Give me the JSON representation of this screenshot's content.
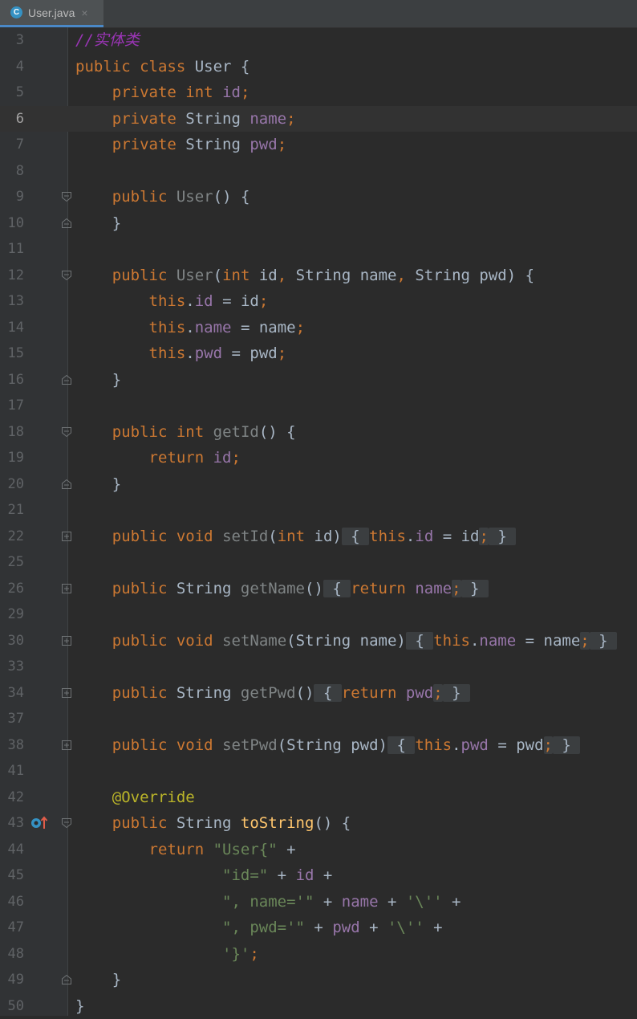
{
  "tab": {
    "file_icon_letter": "C",
    "file_name": "User.java",
    "close_glyph": "×"
  },
  "colors": {
    "keyword": "#cc7832",
    "field": "#9876aa",
    "method_declaration": "#ffc66d",
    "unused_method": "#7f8485",
    "string": "#6a8759",
    "annotation": "#bbb529",
    "comment": "#9a35b5",
    "plain": "#a9b7c6",
    "background": "#2b2b2b"
  },
  "gutter": {
    "icons": [
      "fold-open-icon",
      "fold-close-icon",
      "fold-expand-icon",
      "override-method-icon"
    ]
  },
  "lines": [
    {
      "num": "3",
      "text": "//实体类"
    },
    {
      "num": "4",
      "text": "public class User {"
    },
    {
      "num": "5",
      "text": "    private int id;"
    },
    {
      "num": "6",
      "text": "    private String name;",
      "current": true
    },
    {
      "num": "7",
      "text": "    private String pwd;"
    },
    {
      "num": "8",
      "text": ""
    },
    {
      "num": "9",
      "text": "    public User() {"
    },
    {
      "num": "10",
      "text": "    }"
    },
    {
      "num": "11",
      "text": ""
    },
    {
      "num": "12",
      "text": "    public User(int id, String name, String pwd) {"
    },
    {
      "num": "13",
      "text": "        this.id = id;"
    },
    {
      "num": "14",
      "text": "        this.name = name;"
    },
    {
      "num": "15",
      "text": "        this.pwd = pwd;"
    },
    {
      "num": "16",
      "text": "    }"
    },
    {
      "num": "17",
      "text": ""
    },
    {
      "num": "18",
      "text": "    public int getId() {"
    },
    {
      "num": "19",
      "text": "        return id;"
    },
    {
      "num": "20",
      "text": "    }"
    },
    {
      "num": "21",
      "text": ""
    },
    {
      "num": "22",
      "text": "    public void setId(int id) { this.id = id; }"
    },
    {
      "num": "25",
      "text": ""
    },
    {
      "num": "26",
      "text": "    public String getName() { return name; }"
    },
    {
      "num": "29",
      "text": ""
    },
    {
      "num": "30",
      "text": "    public void setName(String name) { this.name = name; }"
    },
    {
      "num": "33",
      "text": ""
    },
    {
      "num": "34",
      "text": "    public String getPwd() { return pwd; }"
    },
    {
      "num": "37",
      "text": ""
    },
    {
      "num": "38",
      "text": "    public void setPwd(String pwd) { this.pwd = pwd; }"
    },
    {
      "num": "41",
      "text": ""
    },
    {
      "num": "42",
      "text": "    @Override"
    },
    {
      "num": "43",
      "text": "    public String toString() {"
    },
    {
      "num": "44",
      "text": "        return \"User{\" +"
    },
    {
      "num": "45",
      "text": "                \"id=\" + id +"
    },
    {
      "num": "46",
      "text": "                \", name='\" + name + '\\'' +"
    },
    {
      "num": "47",
      "text": "                \", pwd='\" + pwd + '\\'' +"
    },
    {
      "num": "48",
      "text": "                '}';"
    },
    {
      "num": "49",
      "text": "    }"
    },
    {
      "num": "50",
      "text": "}"
    }
  ]
}
